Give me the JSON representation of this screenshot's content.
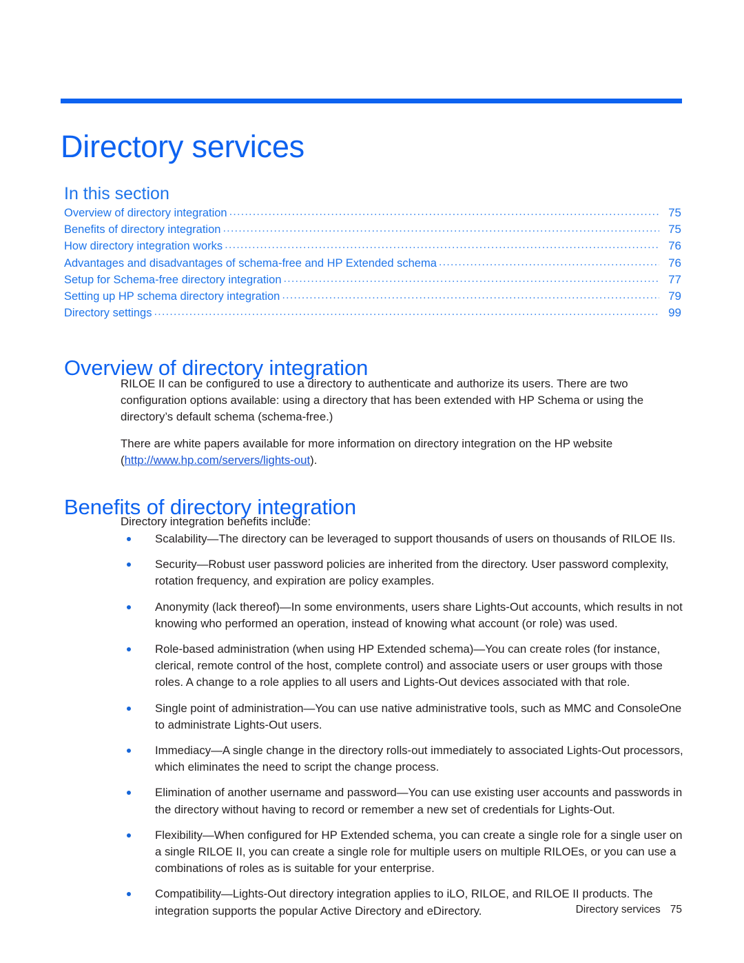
{
  "chapter": {
    "title": "Directory services",
    "rule_color": "#0d62f0",
    "heading_color": "#0d62f0"
  },
  "in_this_section": {
    "heading": "In this section",
    "leader": "...................................................................................................................................................................",
    "entries": [
      {
        "label": "Overview of directory integration",
        "page": "75"
      },
      {
        "label": "Benefits of directory integration",
        "page": "75"
      },
      {
        "label": "How directory integration works",
        "page": "76"
      },
      {
        "label": "Advantages and disadvantages of schema-free and HP Extended schema",
        "page": "76"
      },
      {
        "label": "Setup for Schema-free directory integration",
        "page": "77"
      },
      {
        "label": "Setting up HP schema directory integration",
        "page": "79"
      },
      {
        "label": "Directory settings",
        "page": "99"
      }
    ]
  },
  "overview": {
    "heading": "Overview of directory integration",
    "paragraph_1": "RILOE II can be configured to use a directory to authenticate and authorize its users. There are two configuration options available: using a directory that has been extended with HP Schema or using the directory’s default schema (schema-free.)",
    "paragraph_2_before": "There are white papers available for more information on directory integration on the HP website (",
    "link_text": "http://www.hp.com/servers/lights-out",
    "paragraph_2_after": ")."
  },
  "benefits": {
    "heading": "Benefits of directory integration",
    "intro": "Directory integration benefits include:",
    "items": [
      "Scalability—The directory can be leveraged to support thousands of users on thousands of RILOE IIs.",
      "Security—Robust user password policies are inherited from the directory. User password complexity, rotation frequency, and expiration are policy examples.",
      "Anonymity (lack thereof)—In some environments, users share Lights-Out accounts, which results in not knowing who performed an operation, instead of knowing what account (or role) was used.",
      "Role-based administration (when using HP Extended schema)—You can create roles (for instance, clerical, remote control of the host, complete control) and associate users or user groups with those roles. A change to a role applies to all users and Lights-Out devices associated with that role.",
      "Single point of administration—You can use native administrative tools, such as MMC and ConsoleOne to administrate Lights-Out users.",
      "Immediacy—A single change in the directory rolls-out immediately to associated Lights-Out processors, which eliminates the need to script the change process.",
      "Elimination of another username and password—You can use existing user accounts and passwords in the directory without having to record or remember a new set of credentials for Lights-Out.",
      "Flexibility—When configured for HP Extended schema, you can create a single role for a single user on a single RILOE II, you can create a single role for multiple users on multiple RILOEs, or you can use a combinations of roles as is suitable for your enterprise.",
      "Compatibility—Lights-Out directory integration applies to iLO, RILOE, and RILOE II products. The integration supports the popular Active Directory and eDirectory."
    ]
  },
  "footer": {
    "chapter_name": "Directory services",
    "page_number": "75"
  }
}
